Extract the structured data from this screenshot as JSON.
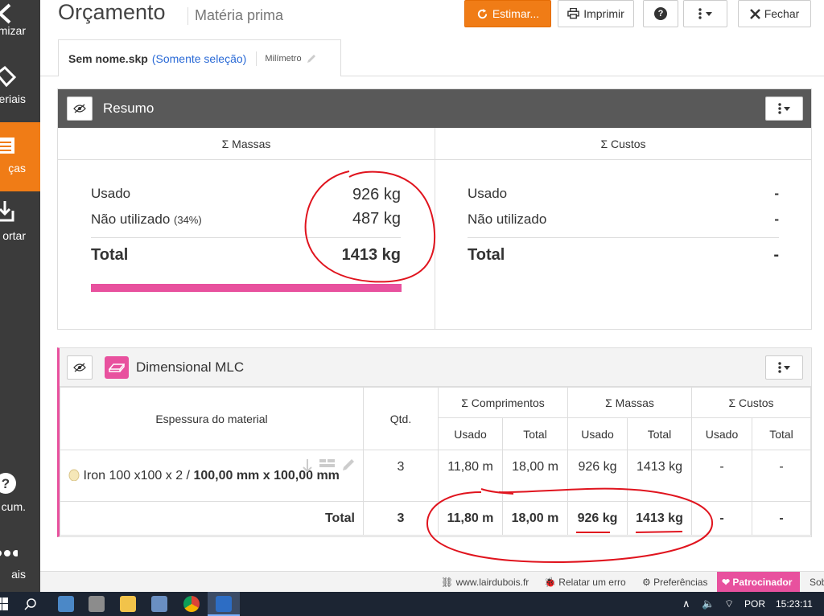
{
  "sidebar": {
    "items": [
      {
        "label": "mizar",
        "icon": "chevron-left-icon"
      },
      {
        "label": "eriais",
        "icon": "tag-icon"
      },
      {
        "label": "ças",
        "icon": "list-icon",
        "active": true
      },
      {
        "label": "ortar",
        "icon": "export-icon"
      },
      {
        "label": "cum.",
        "icon": "help-icon"
      },
      {
        "label": "ais",
        "icon": "more-dots-icon"
      }
    ]
  },
  "header": {
    "title": "Orçamento",
    "subtitle": "Matéria prima",
    "estimate_label": "Estimar...",
    "print_label": "Imprimir",
    "help_label": "?",
    "close_label": "Fechar"
  },
  "tab": {
    "filename": "Sem nome.skp",
    "selection": "(Somente seleção)",
    "unit": "Milímetro"
  },
  "summary": {
    "title": "Resumo",
    "mass_header": "Σ Massas",
    "cost_header": "Σ Custos",
    "used_label": "Usado",
    "used_value": "926 kg",
    "unused_label": "Não utilizado",
    "unused_pct": "(34%)",
    "unused_value": "487 kg",
    "total_label": "Total",
    "total_value": "1413 kg",
    "used_fraction": 1.0,
    "cost_used_label": "Usado",
    "cost_used_value": "-",
    "cost_unused_label": "Não utilizado",
    "cost_unused_value": "-",
    "cost_total_label": "Total",
    "cost_total_value": "-",
    "bar_color": "#e8519e"
  },
  "material": {
    "name": "Dimensional MLC",
    "color": "#e8519e",
    "headers": {
      "thickness": "Espessura do material",
      "qty": "Qtd.",
      "lengths": "Σ Comprimentos",
      "masses": "Σ Massas",
      "costs": "Σ Custos",
      "used": "Usado",
      "total": "Total"
    },
    "row": {
      "name_prefix": "Iron 100 x100 x 2 /",
      "dims": "100,00 mm x 100,00 mm",
      "qty": "3",
      "len_used": "11,80 m",
      "len_total": "18,00 m",
      "mass_used": "926 kg",
      "mass_total": "1413 kg",
      "cost_used": "-",
      "cost_total": "-"
    },
    "total_row": {
      "label": "Total",
      "qty": "3",
      "len_used": "11,80 m",
      "len_total": "18,00 m",
      "mass_used": "926 kg",
      "mass_total": "1413 kg",
      "cost_used": "-",
      "cost_total": "-"
    }
  },
  "footer": {
    "site": "www.lairdubois.fr",
    "bug": "Relatar um erro",
    "prefs": "Preferências",
    "sponsor": "Patrocinador",
    "more": "Sob"
  },
  "taskbar": {
    "lang": "POR",
    "time": "15:23:11"
  },
  "colors": {
    "accent": "#f07c16",
    "dark_panel": "#595959",
    "annotation": "#e0141e"
  }
}
